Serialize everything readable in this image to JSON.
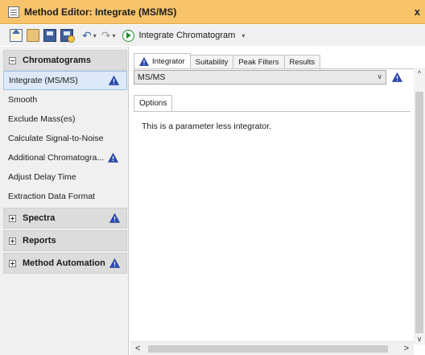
{
  "window": {
    "title": "Method Editor: Integrate (MS/MS)",
    "close_glyph": "x"
  },
  "toolbar": {
    "undo_glyph": "↶",
    "redo_glyph": "↷",
    "caret_glyph": "▾",
    "run_label": "Integrate Chromatogram"
  },
  "sidebar": {
    "chromatograms_header": "Chromatograms",
    "items": [
      {
        "label": "Integrate (MS/MS)",
        "warning": true,
        "selected": true
      },
      {
        "label": "Smooth",
        "warning": false
      },
      {
        "label": "Exclude Mass(es)",
        "warning": false
      },
      {
        "label": "Calculate Signal-to-Noise",
        "warning": false
      },
      {
        "label": "Additional Chromatogra...",
        "warning": true
      },
      {
        "label": "Adjust Delay Time",
        "warning": false
      },
      {
        "label": "Extraction Data Format",
        "warning": false
      }
    ],
    "spectra_header": "Spectra",
    "reports_header": "Reports",
    "method_automation_header": "Method Automation"
  },
  "tabs": [
    {
      "label": "Integrator",
      "active": true,
      "warning": true
    },
    {
      "label": "Suitability",
      "active": false
    },
    {
      "label": "Peak Filters",
      "active": false
    },
    {
      "label": "Results",
      "active": false
    }
  ],
  "integrator": {
    "selected_value": "MS/MS",
    "dropdown_arrow": "∨",
    "options_tab": "Options",
    "message": "This is a parameter less integrator."
  },
  "scrollbars": {
    "up": "^",
    "down": "∨",
    "left": "<",
    "right": ">"
  },
  "colors": {
    "title_bar": "#f7c46c",
    "warning_icon": "#2a4bb5",
    "selected_item": "#dde9f8"
  }
}
